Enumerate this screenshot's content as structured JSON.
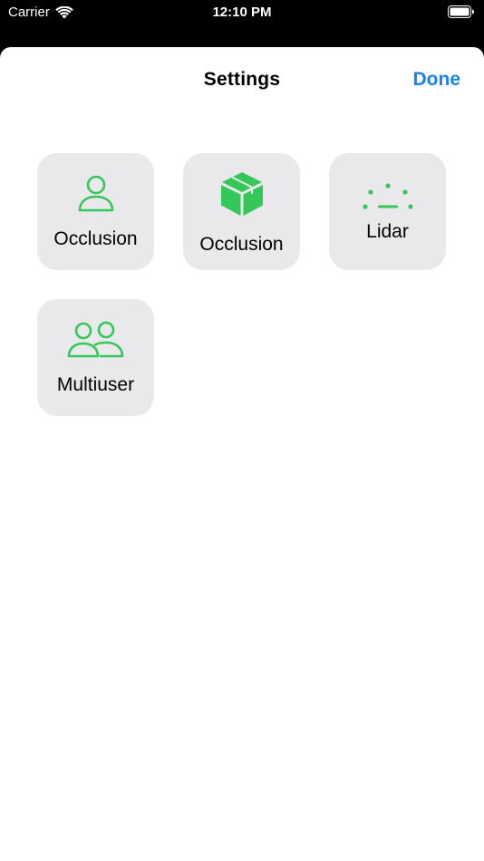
{
  "status_bar": {
    "carrier": "Carrier",
    "time": "12:10 PM"
  },
  "header": {
    "title": "Settings",
    "done_label": "Done"
  },
  "accent_color": "#34c759",
  "link_color": "#1a82f0",
  "tiles": [
    {
      "label": "Occlusion",
      "icon": "person-icon"
    },
    {
      "label": "Occlusion",
      "icon": "cube-icon"
    },
    {
      "label": "Lidar",
      "icon": "lidar-icon"
    },
    {
      "label": "Multiuser",
      "icon": "two-people-icon"
    }
  ]
}
